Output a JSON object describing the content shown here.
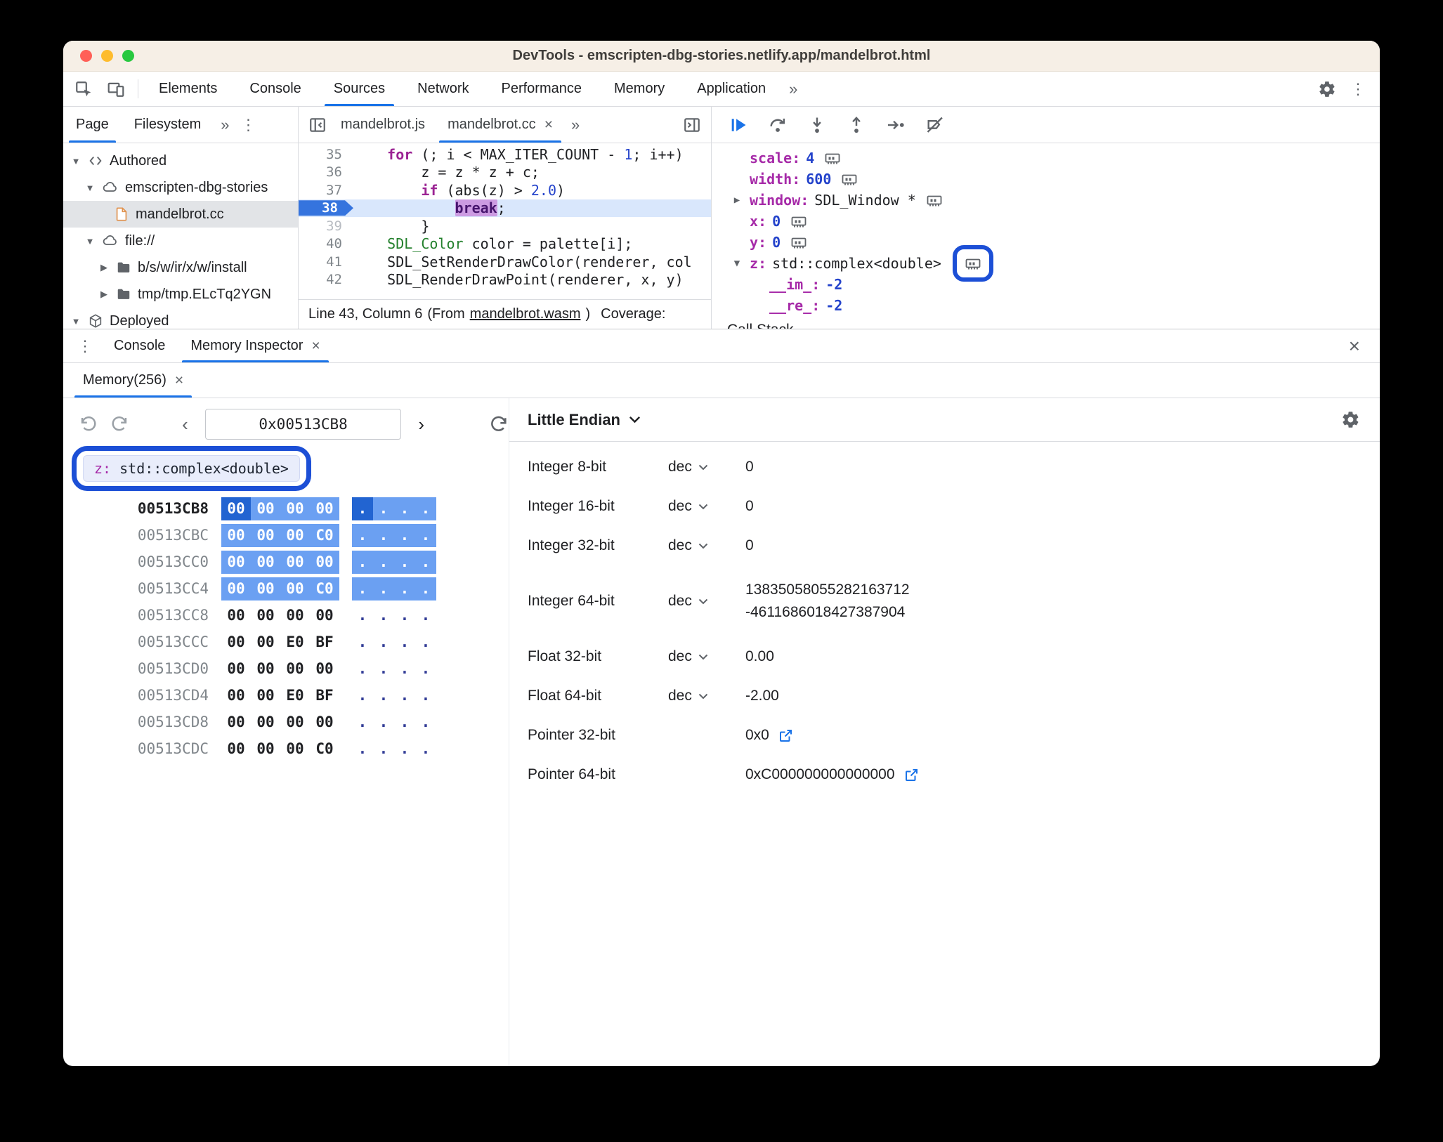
{
  "glyphs": {
    "close": "×",
    "kebab": "⋮",
    "overflow": "»",
    "expand": "▼",
    "collapse": "▶",
    "prev": "‹",
    "next": "›",
    "dot": "."
  },
  "colors": {
    "accent": "#1a73e8",
    "annotation": "#1c4fd6",
    "hex_highlight": "#6ba0f2",
    "hex_selected": "#2264d1",
    "exec_line": "#d9e7fc"
  },
  "titlebar": {
    "title": "DevTools - emscripten-dbg-stories.netlify.app/mandelbrot.html"
  },
  "toolbar": {
    "tabs": [
      "Elements",
      "Console",
      "Sources",
      "Network",
      "Performance",
      "Memory",
      "Application"
    ]
  },
  "sidebar": {
    "tab_page": "Page",
    "tab_filesystem": "Filesystem",
    "tree": {
      "authored": "Authored",
      "site": "emscripten-dbg-stories",
      "file": "mandelbrot.cc",
      "fileproto": "file://",
      "folder1": "b/s/w/ir/x/w/install",
      "folder2": "tmp/tmp.ELcTq2YGN",
      "deployed": "Deployed"
    }
  },
  "editor": {
    "tab_js": "mandelbrot.js",
    "tab_cc": "mandelbrot.cc",
    "lines": [
      {
        "num": "35",
        "ind": "    ",
        "s0": "for",
        "s1": " (; i < MAX_ITER_COUNT - ",
        "s2": "1",
        "s3": "; i++)"
      },
      {
        "num": "36",
        "ind": "        ",
        "s0": "z = z * z + c;"
      },
      {
        "num": "37",
        "ind": "        ",
        "s0": "if",
        "s1": " (abs(z) > ",
        "s2": "2.0",
        "s3": ")"
      },
      {
        "num": "38",
        "ind": "            ",
        "s0": "break",
        "s1": ";"
      },
      {
        "num": "39",
        "ind": "        ",
        "s0": "}"
      },
      {
        "num": "40",
        "ind": "    ",
        "s0": "SDL_Color",
        "s1": " color = palette[i];"
      },
      {
        "num": "41",
        "ind": "    ",
        "s0": "SDL_SetRenderDrawColor(renderer, col"
      },
      {
        "num": "42",
        "ind": "    ",
        "s0": "SDL_RenderDrawPoint(renderer, x, y)"
      }
    ],
    "status": {
      "pos": "Line 43, Column 6",
      "from": "(From",
      "link": "mandelbrot.wasm",
      "close": ")",
      "coverage": "Coverage:"
    }
  },
  "scope": {
    "rows": [
      {
        "name": "scale:",
        "value": "4"
      },
      {
        "name": "width:",
        "value": "600"
      },
      {
        "name": "window:",
        "value": "SDL_Window *"
      },
      {
        "name": "x:",
        "value": "0"
      },
      {
        "name": "y:",
        "value": "0"
      },
      {
        "name": "z:",
        "value": "std::complex<double>"
      },
      {
        "name": "__im_:",
        "value": "-2"
      },
      {
        "name": "__re_:",
        "value": "-2"
      }
    ],
    "call_stack": "Call Stack"
  },
  "drawer": {
    "tab_console": "Console",
    "tab_memory_inspector": "Memory Inspector",
    "mem_tab": "Memory(256)"
  },
  "memory": {
    "address": "0x00513CB8",
    "tag_name": "z: ",
    "tag_type": "std::complex<double>",
    "rows": [
      {
        "addr": "00513CB8",
        "bytes": [
          "00",
          "00",
          "00",
          "00"
        ]
      },
      {
        "addr": "00513CBC",
        "bytes": [
          "00",
          "00",
          "00",
          "C0"
        ]
      },
      {
        "addr": "00513CC0",
        "bytes": [
          "00",
          "00",
          "00",
          "00"
        ]
      },
      {
        "addr": "00513CC4",
        "bytes": [
          "00",
          "00",
          "00",
          "C0"
        ]
      },
      {
        "addr": "00513CC8",
        "bytes": [
          "00",
          "00",
          "00",
          "00"
        ]
      },
      {
        "addr": "00513CCC",
        "bytes": [
          "00",
          "00",
          "E0",
          "BF"
        ]
      },
      {
        "addr": "00513CD0",
        "bytes": [
          "00",
          "00",
          "00",
          "00"
        ]
      },
      {
        "addr": "00513CD4",
        "bytes": [
          "00",
          "00",
          "E0",
          "BF"
        ]
      },
      {
        "addr": "00513CD8",
        "bytes": [
          "00",
          "00",
          "00",
          "00"
        ]
      },
      {
        "addr": "00513CDC",
        "bytes": [
          "00",
          "00",
          "00",
          "C0"
        ]
      }
    ]
  },
  "values": {
    "endianness": "Little Endian",
    "rows": [
      {
        "label": "Integer 8-bit",
        "mode": "dec",
        "value": "0"
      },
      {
        "label": "Integer 16-bit",
        "mode": "dec",
        "value": "0"
      },
      {
        "label": "Integer 32-bit",
        "mode": "dec",
        "value": "0"
      },
      {
        "label": "Integer 64-bit",
        "mode": "dec",
        "value": "13835058055282163712",
        "value2": "-4611686018427387904"
      },
      {
        "label": "Float 32-bit",
        "mode": "dec",
        "value": "0.00"
      },
      {
        "label": "Float 64-bit",
        "mode": "dec",
        "value": "-2.00"
      },
      {
        "label": "Pointer 32-bit",
        "value": "0x0"
      },
      {
        "label": "Pointer 64-bit",
        "value": "0xC000000000000000"
      }
    ]
  }
}
